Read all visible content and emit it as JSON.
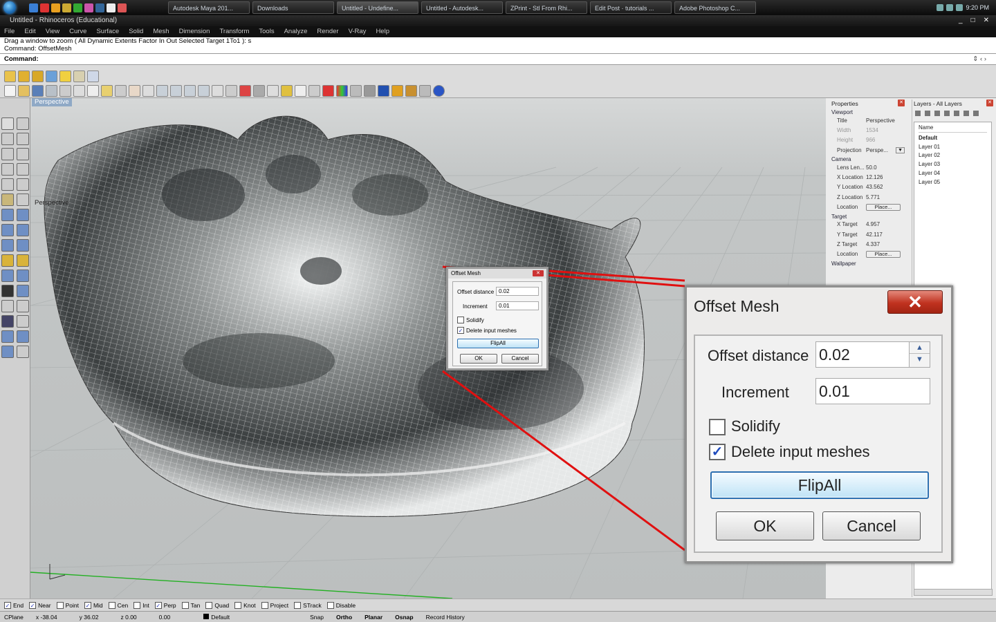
{
  "taskbar": {
    "tasks": [
      "Autodesk Maya 201...",
      "Downloads",
      "Untitled - Undefine...",
      "Untitled - Autodesk...",
      "ZPrint - Stl From Rhi...",
      "Edit Post · tutorials ...",
      "Adobe Photoshop C..."
    ],
    "clock": "9:20 PM"
  },
  "window": {
    "title": "Untitled - Rhinoceros (Educational)",
    "controls": [
      "_",
      "□",
      "✕"
    ]
  },
  "menu": [
    "File",
    "Edit",
    "View",
    "Curve",
    "Surface",
    "Solid",
    "Mesh",
    "Dimension",
    "Transform",
    "Tools",
    "Analyze",
    "Render",
    "V-Ray",
    "Help"
  ],
  "command": {
    "history_1": "Drag a window to zoom ( All  Dynamic  Extents  Factor  In  Out  Selected  Target  1To1 ): s",
    "history_2": "Command: OffsetMesh",
    "prompt": "Command:"
  },
  "viewport": {
    "tab": "Perspective",
    "label": "Perspective"
  },
  "properties": {
    "title": "Properties",
    "viewport_section": "Viewport",
    "rows_viewport": [
      {
        "k": "Title",
        "v": "Perspective"
      },
      {
        "k": "Width",
        "v": "1534"
      },
      {
        "k": "Height",
        "v": "966"
      },
      {
        "k": "Projection",
        "v": "Perspe..."
      }
    ],
    "camera_section": "Camera",
    "rows_camera": [
      {
        "k": "Lens Len...",
        "v": "50.0"
      },
      {
        "k": "X Location",
        "v": "12.126"
      },
      {
        "k": "Y Location",
        "v": "43.562"
      },
      {
        "k": "Z Location",
        "v": "5.771"
      },
      {
        "k": "Location",
        "v": "Place..."
      }
    ],
    "target_section": "Target",
    "rows_target": [
      {
        "k": "X Target",
        "v": "4.957"
      },
      {
        "k": "Y Target",
        "v": "42.117"
      },
      {
        "k": "Z Target",
        "v": "4.337"
      },
      {
        "k": "Location",
        "v": "Place..."
      }
    ],
    "wallpaper_section": "Wallpaper"
  },
  "layers": {
    "title": "Layers - All Layers",
    "column": "Name",
    "items": [
      "Default",
      "Layer 01",
      "Layer 02",
      "Layer 03",
      "Layer 04",
      "Layer 05"
    ]
  },
  "snaps": [
    {
      "label": "End",
      "checked": true
    },
    {
      "label": "Near",
      "checked": true
    },
    {
      "label": "Point",
      "checked": false
    },
    {
      "label": "Mid",
      "checked": true
    },
    {
      "label": "Cen",
      "checked": false
    },
    {
      "label": "Int",
      "checked": false
    },
    {
      "label": "Perp",
      "checked": true
    },
    {
      "label": "Tan",
      "checked": false
    },
    {
      "label": "Quad",
      "checked": false
    },
    {
      "label": "Knot",
      "checked": false
    },
    {
      "label": "Project",
      "checked": false
    },
    {
      "label": "STrack",
      "checked": false
    },
    {
      "label": "Disable",
      "checked": false
    }
  ],
  "status": {
    "cplane": "CPlane",
    "x": "x -38.04",
    "y": "y 36.02",
    "z": "z 0.00",
    "extra": "0.00",
    "layer": "Default",
    "snap": "Snap",
    "ortho": "Ortho",
    "planar": "Planar",
    "osnap": "Osnap",
    "record": "Record History"
  },
  "dialog": {
    "title": "Offset Mesh",
    "close": "✕",
    "offset_label": "Offset distance",
    "offset_value": "0.02",
    "increment_label": "Increment",
    "increment_value": "0.01",
    "solidify_label": "Solidify",
    "delete_label": "Delete input meshes",
    "flip_label": "FlipAll",
    "ok_label": "OK",
    "cancel_label": "Cancel",
    "check_glyph": "✓",
    "spin_up": "▲",
    "spin_down": "▼"
  },
  "colors": {
    "callout_line": "#e01010",
    "axis_green": "#22b022"
  }
}
